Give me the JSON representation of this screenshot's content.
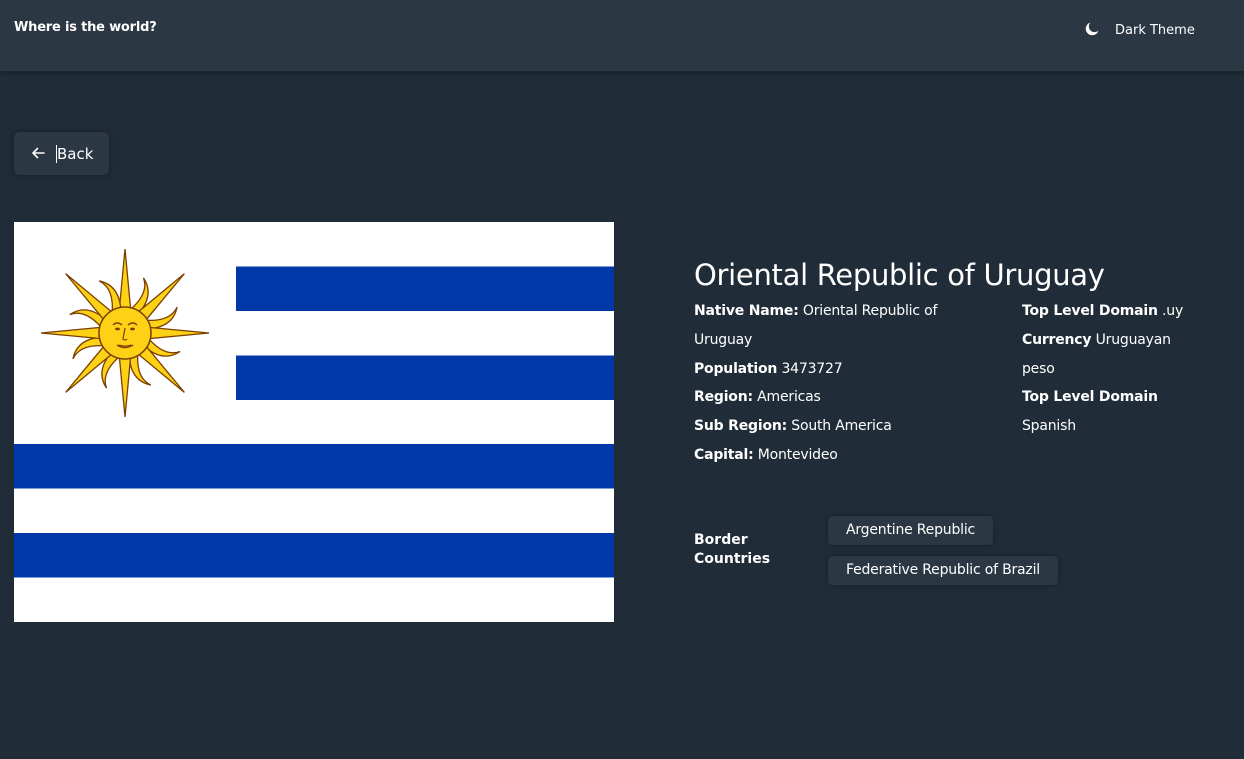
{
  "header": {
    "title": "Where is the world?",
    "theme_icon": "moon-icon",
    "theme_label": "Dark Theme"
  },
  "back": {
    "icon": "arrow-left-icon",
    "label": "Back"
  },
  "flag": {
    "alt": "Flag of Uruguay",
    "colors": {
      "white": "#ffffff",
      "blue": "#0038a8",
      "sun": "#fcd116",
      "sun_outline": "#7b3f00"
    }
  },
  "country": {
    "name": "Oriental Republic of Uruguay",
    "native_name_label": "Native Name:",
    "native_name": "Oriental Republic of Uruguay",
    "population_label": "Population",
    "population": "3473727",
    "region_label": "Region:",
    "region": "Americas",
    "subregion_label": "Sub Region:",
    "subregion": "South America",
    "capital_label": "Capital:",
    "capital": "Montevideo",
    "tld_label": "Top Level Domain",
    "tld": ".uy",
    "currency_label": "Currency",
    "currency": "Uruguayan peso",
    "languages_label": "Top Level Domain",
    "languages": "Spanish"
  },
  "borders": {
    "label": "Border Countries",
    "items": [
      "Argentine Republic",
      "Federative Republic of Brazil"
    ]
  },
  "colors": {
    "background": "#202c37",
    "surface": "#2b3743",
    "text": "#ffffff"
  }
}
